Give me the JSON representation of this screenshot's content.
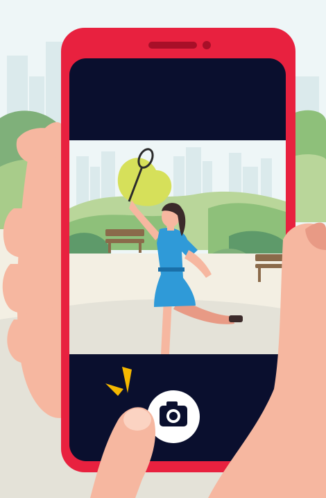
{
  "icons": {
    "shutter": "camera-icon",
    "flip": "flash-icon"
  },
  "colors": {
    "phone_body": "#e8213f",
    "screen_dark": "#0a0f2e",
    "sky": "#eef6f7",
    "city": "#dbeaec",
    "bush_light": "#b9d69a",
    "bush_mid": "#8ec07a",
    "bush_dark": "#5e9a6a",
    "ground": "#f3efe3",
    "path": "#e4e2d8",
    "skin": "#f6b7a0",
    "skin_dark": "#e89a85",
    "dress": "#2f9ad8",
    "hair": "#3b2a2a",
    "accent_yellow": "#f5b800",
    "shutter_white": "#ffffff",
    "bench": "#8a6a4a"
  }
}
